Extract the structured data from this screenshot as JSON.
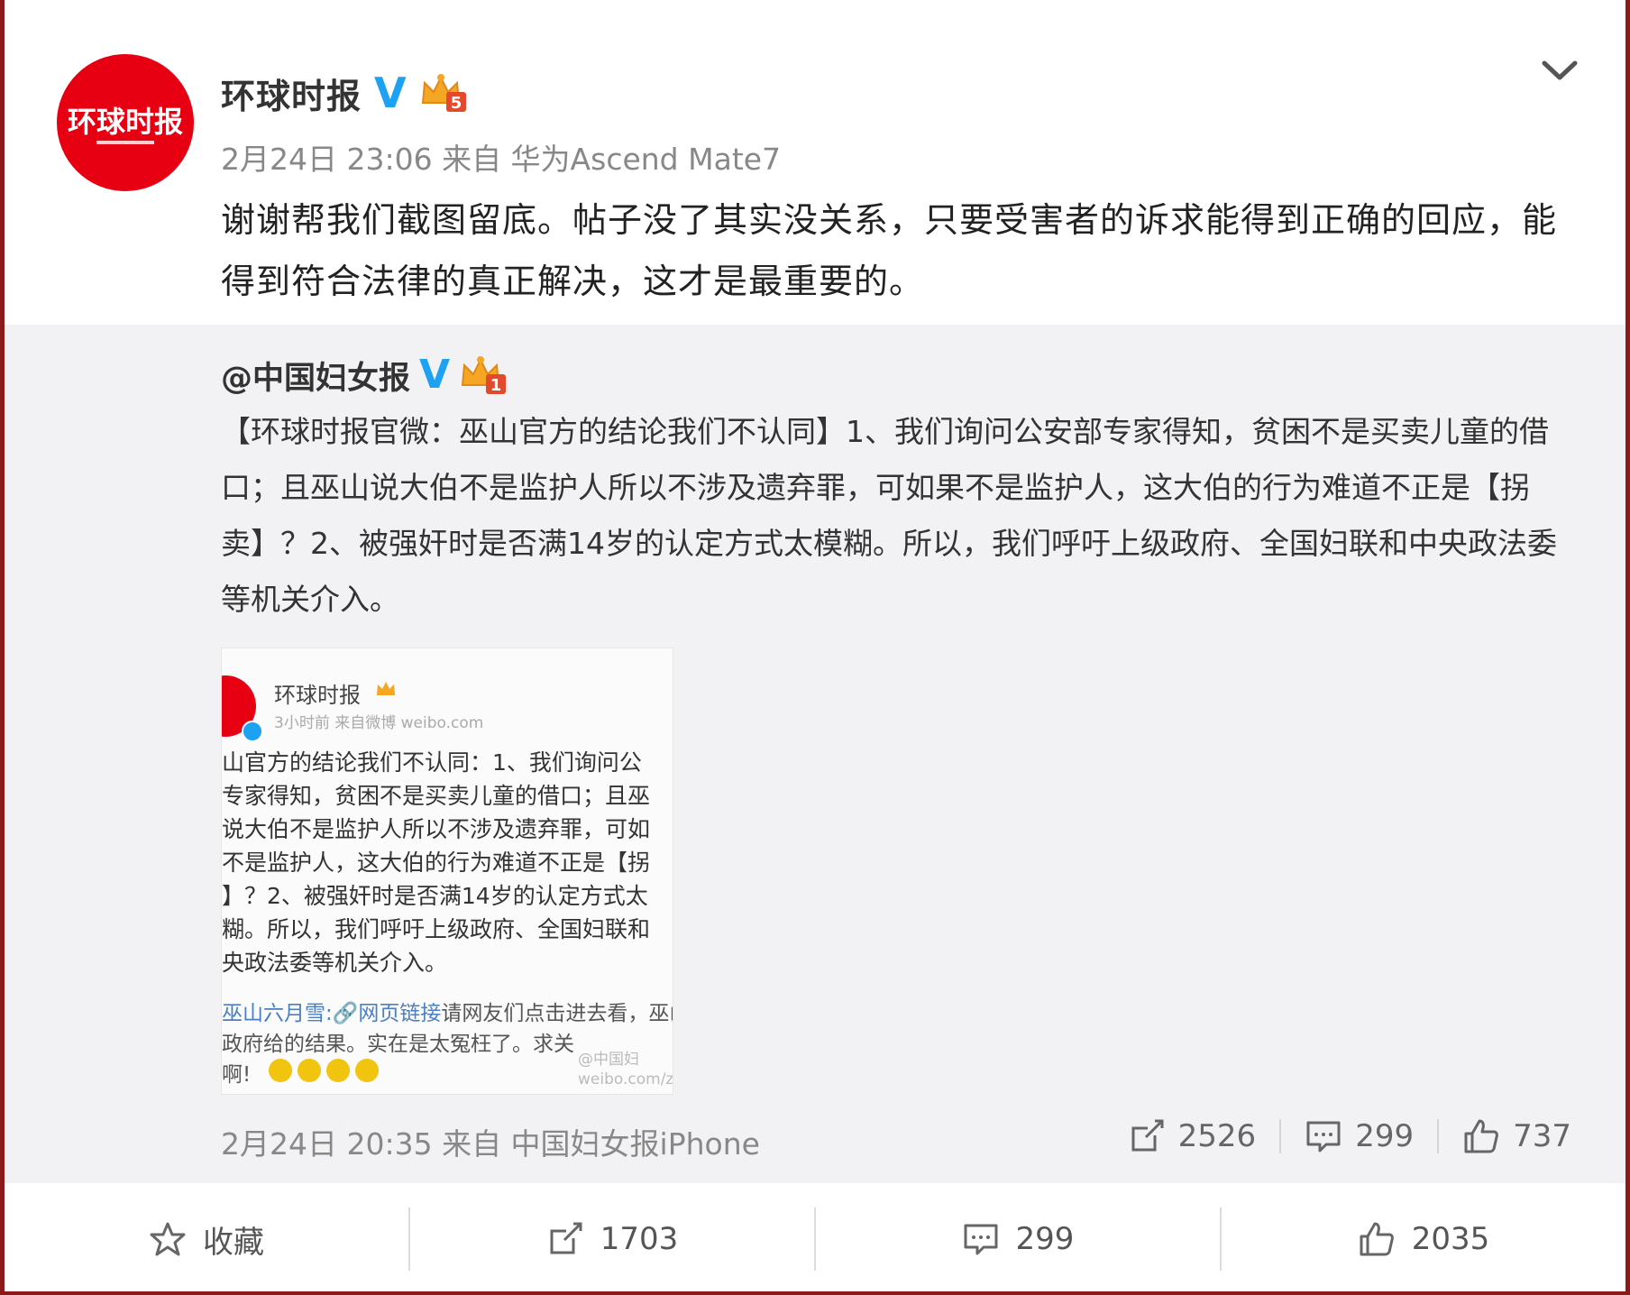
{
  "post": {
    "author": "环球时报",
    "avatar_text": "环球时报",
    "crown_level": "5",
    "timestamp": "2月24日 23:06 来自 华为Ascend Mate7",
    "text": "谢谢帮我们截图留底。帖子没了其实没关系，只要受害者的诉求能得到正确的回应，能得到符合法律的真正解决，这才是最重要的。"
  },
  "repost": {
    "author": "@中国妇女报",
    "crown_level": "1",
    "text": "【环球时报官微：巫山官方的结论我们不认同】1、我们询问公安部专家得知，贫困不是买卖儿童的借口；且巫山说大伯不是监护人所以不涉及遗弃罪，可如果不是监护人，这大伯的行为难道不正是【拐卖】？2、被强奸时是否满14岁的认定方式太模糊。所以，我们呼吁上级政府、全国妇联和中央政法委等机关介入。",
    "thumbnail": {
      "name": "环球时报",
      "meta": "3小时前  来自微博 weibo.com",
      "text": "山官方的结论我们不认同：1、我们询问公\n专家得知，贫困不是买卖儿童的借口；且巫\n说大伯不是监护人所以不涉及遗弃罪，可如\n不是监护人，这大伯的行为难道不正是【拐\n】？2、被强奸时是否满14岁的认定方式太\n糊。所以，我们呼吁上级政府、全国妇联和\n央政法委等机关介入。",
      "sub_user": "巫山六月雪:",
      "sub_link": "网页链接",
      "sub_text": "请网友们点击进去看，巫山政府给的结果。实在是太冤枉了。求关",
      "sub_text2": "啊!",
      "watermark": "@中国妇\nweibo.com/z"
    },
    "timestamp": "2月24日 20:35 来自 中国妇女报iPhone",
    "reposts": "2526",
    "comments": "299",
    "likes": "737"
  },
  "actions": {
    "favorite": "收藏",
    "reposts": "1703",
    "comments": "299",
    "likes": "2035"
  },
  "colors": {
    "verified": "#1da1f2",
    "brand_red": "#e60012",
    "crown": "#f5a623"
  }
}
